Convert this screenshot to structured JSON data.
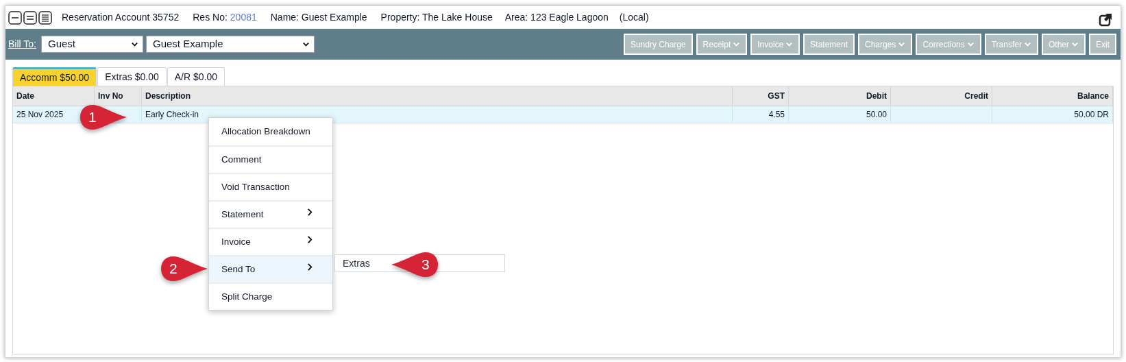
{
  "header": {
    "title": "Reservation Account 35752",
    "res_no_label": "Res No:",
    "res_no": "20081",
    "name": "Name: Guest Example",
    "property": "Property: The Lake House",
    "area": "Area: 123 Eagle Lagoon",
    "local": "(Local)"
  },
  "toolbar": {
    "bill_to": "Bill To:",
    "bill_to_type": "Guest",
    "bill_to_name": "Guest Example",
    "buttons": [
      {
        "label": "Sundry Charge",
        "dropdown": false
      },
      {
        "label": "Receipt",
        "dropdown": true
      },
      {
        "label": "Invoice",
        "dropdown": true
      },
      {
        "label": "Statement",
        "dropdown": false
      },
      {
        "label": "Charges",
        "dropdown": true
      },
      {
        "label": "Corrections",
        "dropdown": true
      },
      {
        "label": "Transfer",
        "dropdown": true
      },
      {
        "label": "Other",
        "dropdown": true
      },
      {
        "label": "Exit",
        "dropdown": false
      }
    ]
  },
  "tabs": [
    {
      "label": "Accomm $50.00",
      "selected": true
    },
    {
      "label": "Extras $0.00",
      "selected": false
    },
    {
      "label": "A/R $0.00",
      "selected": false
    }
  ],
  "table": {
    "columns": [
      "Date",
      "Inv No",
      "Description",
      "GST",
      "Debit",
      "Credit",
      "Balance"
    ],
    "rows": [
      {
        "selected": true,
        "cells": [
          "25 Nov 2025",
          "",
          "Early Check-in",
          "4.55",
          "50.00",
          "",
          "50.00 DR"
        ]
      }
    ]
  },
  "context_menu": {
    "items": [
      {
        "label": "Allocation Breakdown",
        "submenu": false,
        "selected": false
      },
      {
        "label": "Comment",
        "submenu": false,
        "selected": false
      },
      {
        "label": "Void Transaction",
        "submenu": false,
        "selected": false
      },
      {
        "label": "Statement",
        "submenu": true,
        "selected": false
      },
      {
        "label": "Invoice",
        "submenu": true,
        "selected": false
      },
      {
        "label": "Send To",
        "submenu": true,
        "selected": true
      },
      {
        "label": "Split Charge",
        "submenu": false,
        "selected": false
      }
    ],
    "submenu": {
      "items": [
        "Extras"
      ]
    }
  },
  "callouts": [
    "1",
    "2",
    "3"
  ]
}
